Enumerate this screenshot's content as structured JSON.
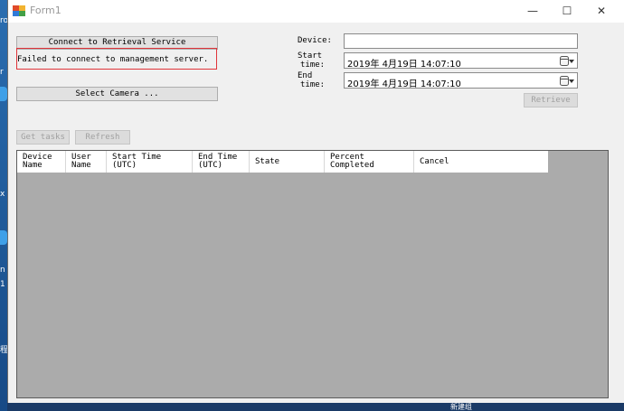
{
  "window": {
    "title": "Form1",
    "minimize_glyph": "—",
    "maximize_glyph": "☐",
    "close_glyph": "✕"
  },
  "left_panel": {
    "connect_button": "Connect to Retrieval Service",
    "status_message": "Failed to connect to management server.",
    "select_camera_button": "Select Camera ..."
  },
  "right_panel": {
    "device_label": "Device:",
    "device_value": "",
    "start_label_1": "Start",
    "start_label_2": "time:",
    "start_value": "2019年 4月19日 14:07:10",
    "end_label_1": "End",
    "end_label_2": "time:",
    "end_value": "2019年 4月19日 14:07:10",
    "retrieve_button": "Retrieve"
  },
  "tasks": {
    "get_tasks_button": "Get tasks",
    "refresh_button": "Refresh"
  },
  "grid": {
    "columns": [
      {
        "line1": "Device",
        "line2": "Name"
      },
      {
        "line1": "User",
        "line2": "Name"
      },
      {
        "line1": "Start Time",
        "line2": "(UTC)"
      },
      {
        "line1": "End Time",
        "line2": "(UTC)"
      },
      {
        "line1": "State",
        "line2": ""
      },
      {
        "line1": "Percent",
        "line2": "Completed"
      },
      {
        "line1": "Cancel",
        "line2": ""
      }
    ],
    "rows": []
  },
  "desktop": {
    "frag_1": "ro",
    "frag_2": "r",
    "frag_3": "x",
    "frag_4": "n",
    "frag_5": "1",
    "frag_6": "程",
    "taskbar_text": "新建组"
  },
  "colors": {
    "error_border": "#e0343a",
    "grid_background": "#ababab"
  }
}
